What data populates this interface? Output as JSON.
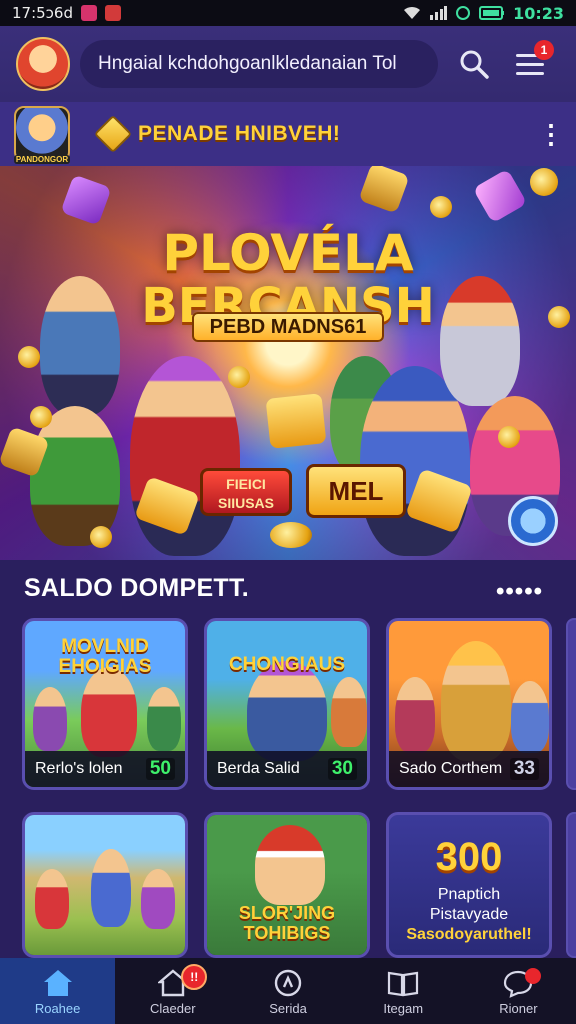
{
  "status_bar": {
    "left_text": "17:5ɔ6d",
    "clock": "10:23"
  },
  "header": {
    "search_text": "Hngaial kchdohgoanlkledanaian Tol",
    "notification_count": "1"
  },
  "promo": {
    "avatar_caption": "PANDONGOR",
    "title": "PENADE HNIBVEH!"
  },
  "hero": {
    "title_line1": "PLOVÉLA",
    "title_line2": "BERCANSH",
    "subtitle": "PEBD MADNS61",
    "chip_left": "FIEICI SIIUSAS",
    "chip_right": "MEL"
  },
  "section": {
    "title": "SALDO DOMPETT.",
    "more": "•••••"
  },
  "cards": [
    {
      "banner": "MOVLNID EHOIGIAS",
      "label": "Rerlo's lolen",
      "value": "50"
    },
    {
      "banner": "CHONGIAUS",
      "label": "Berda Salid",
      "value": "30"
    },
    {
      "banner": "",
      "label": "Sado Corthem",
      "value": "33"
    },
    {
      "banner": "",
      "label": "",
      "value": ""
    },
    {
      "banner": "SLOR'JING TOHIBIGS",
      "label": "",
      "value": ""
    },
    {
      "big_number": "300",
      "line1": "Pnaptich",
      "line2": "Pistavyade",
      "line3": "Sasodoyaruthel!"
    }
  ],
  "bottom_nav": [
    {
      "label": "Roahee",
      "icon": "home-icon"
    },
    {
      "label": "Claeder",
      "icon": "calendar-home-icon",
      "badge": "!!"
    },
    {
      "label": "Serida",
      "icon": "wheel-icon"
    },
    {
      "label": "Itegam",
      "icon": "book-icon"
    },
    {
      "label": "Rioner",
      "icon": "chat-icon"
    }
  ],
  "colors": {
    "accent_gold": "#ffd23a",
    "nav_active": "#1f3b88",
    "value_green": "#3ef06a",
    "badge_red": "#e8262c"
  }
}
